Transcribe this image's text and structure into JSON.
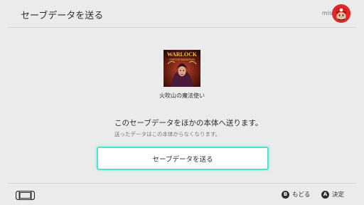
{
  "header": {
    "title": "セーブデータを送る",
    "username": "miso",
    "avatar_icon": "mario-avatar-icon"
  },
  "game": {
    "name": "火吹山の魔法使い",
    "icon_title_line1": "WARLOCK",
    "icon_title_line2": "FIRETOP MOUNTAIN"
  },
  "message": {
    "main": "このセーブデータをほかの本体へ送ります。",
    "sub": "送ったデータはこの本体からなくなります。"
  },
  "button": {
    "label": "セーブデータを送る"
  },
  "footer": {
    "console_icon": "handheld-console-icon",
    "b_key": "B",
    "b_label": "もどる",
    "a_key": "A",
    "a_label": "決定"
  },
  "colors": {
    "background": "#ebebeb",
    "accent": "#4de3d1",
    "avatar": "#e12828"
  }
}
